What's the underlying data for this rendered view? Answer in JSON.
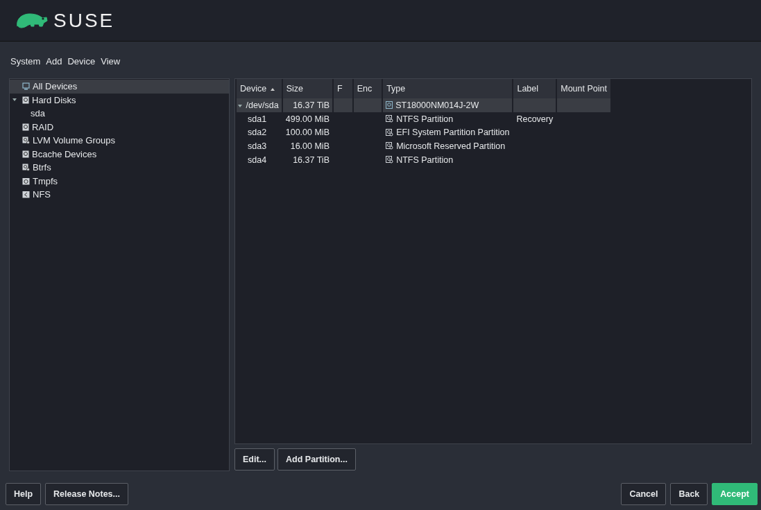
{
  "brand": {
    "name": "SUSE"
  },
  "menu": [
    "System",
    "Add",
    "Device",
    "View"
  ],
  "tree": [
    {
      "label": "All Devices",
      "kind": "computer",
      "selected": true
    },
    {
      "label": "Hard Disks",
      "kind": "disk",
      "selected": false,
      "expanded": true,
      "children": [
        {
          "label": "sda",
          "selected": false
        }
      ]
    },
    {
      "label": "RAID",
      "kind": "disk",
      "selected": false
    },
    {
      "label": "LVM Volume Groups",
      "kind": "group",
      "selected": false
    },
    {
      "label": "Bcache Devices",
      "kind": "disk",
      "selected": false
    },
    {
      "label": "Btrfs",
      "kind": "group",
      "selected": false
    },
    {
      "label": "Tmpfs",
      "kind": "tmpfs",
      "selected": false
    },
    {
      "label": "NFS",
      "kind": "nfs",
      "selected": false
    }
  ],
  "table": {
    "columns": [
      {
        "label": "Device",
        "sorted": true
      },
      {
        "label": "Size",
        "sorted": false
      },
      {
        "label": "F",
        "sorted": false
      },
      {
        "label": "Enc",
        "sorted": false
      },
      {
        "label": "Type",
        "sorted": false
      },
      {
        "label": "Label",
        "sorted": false
      },
      {
        "label": "Mount Point",
        "sorted": false
      }
    ],
    "rows": [
      {
        "device": "/dev/sda",
        "size": "16.37 TiB",
        "type": "ST18000NM014J-2W",
        "kind": "disk",
        "selected": true,
        "expanded": true,
        "children": [
          {
            "device": "sda1",
            "size": "499.00 MiB",
            "type": "NTFS Partition",
            "label": "Recovery",
            "kind": "partition",
            "selected": false
          },
          {
            "device": "sda2",
            "size": "100.00 MiB",
            "type": "EFI System Partition Partition",
            "kind": "partition",
            "selected": false
          },
          {
            "device": "sda3",
            "size": "16.00 MiB",
            "type": "Microsoft Reserved Partition",
            "kind": "partition",
            "selected": false
          },
          {
            "device": "sda4",
            "size": "16.37 TiB",
            "type": "NTFS Partition",
            "kind": "partition",
            "selected": false
          }
        ]
      }
    ]
  },
  "table_buttons": [
    "Edit...",
    "Add Partition..."
  ],
  "left_buttons": [
    "Help",
    "Release Notes..."
  ],
  "right_buttons": [
    {
      "label": "Cancel",
      "primary": false
    },
    {
      "label": "Back",
      "primary": false
    },
    {
      "label": "Accept",
      "primary": true
    }
  ]
}
